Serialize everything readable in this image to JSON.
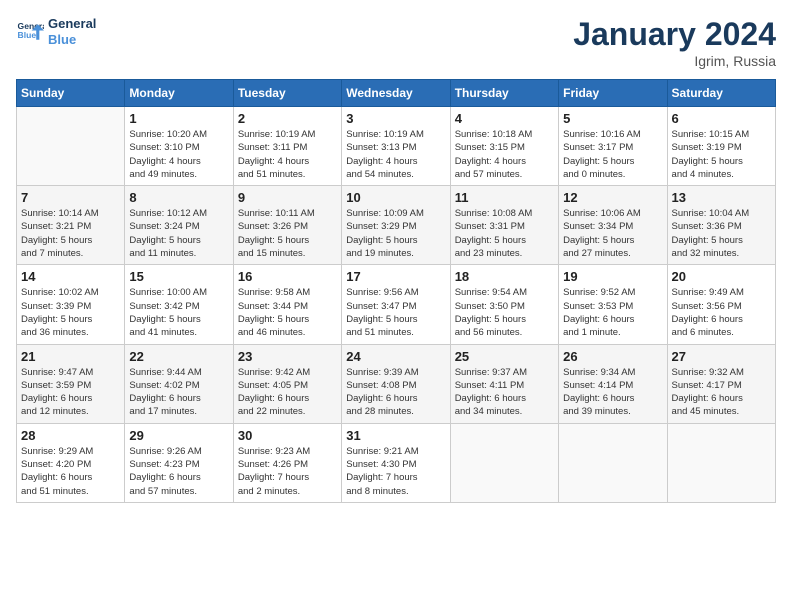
{
  "header": {
    "logo_line1": "General",
    "logo_line2": "Blue",
    "month": "January 2024",
    "location": "Igrim, Russia"
  },
  "weekdays": [
    "Sunday",
    "Monday",
    "Tuesday",
    "Wednesday",
    "Thursday",
    "Friday",
    "Saturday"
  ],
  "weeks": [
    [
      {
        "day": "",
        "info": ""
      },
      {
        "day": "1",
        "info": "Sunrise: 10:20 AM\nSunset: 3:10 PM\nDaylight: 4 hours\nand 49 minutes."
      },
      {
        "day": "2",
        "info": "Sunrise: 10:19 AM\nSunset: 3:11 PM\nDaylight: 4 hours\nand 51 minutes."
      },
      {
        "day": "3",
        "info": "Sunrise: 10:19 AM\nSunset: 3:13 PM\nDaylight: 4 hours\nand 54 minutes."
      },
      {
        "day": "4",
        "info": "Sunrise: 10:18 AM\nSunset: 3:15 PM\nDaylight: 4 hours\nand 57 minutes."
      },
      {
        "day": "5",
        "info": "Sunrise: 10:16 AM\nSunset: 3:17 PM\nDaylight: 5 hours\nand 0 minutes."
      },
      {
        "day": "6",
        "info": "Sunrise: 10:15 AM\nSunset: 3:19 PM\nDaylight: 5 hours\nand 4 minutes."
      }
    ],
    [
      {
        "day": "7",
        "info": "Sunrise: 10:14 AM\nSunset: 3:21 PM\nDaylight: 5 hours\nand 7 minutes."
      },
      {
        "day": "8",
        "info": "Sunrise: 10:12 AM\nSunset: 3:24 PM\nDaylight: 5 hours\nand 11 minutes."
      },
      {
        "day": "9",
        "info": "Sunrise: 10:11 AM\nSunset: 3:26 PM\nDaylight: 5 hours\nand 15 minutes."
      },
      {
        "day": "10",
        "info": "Sunrise: 10:09 AM\nSunset: 3:29 PM\nDaylight: 5 hours\nand 19 minutes."
      },
      {
        "day": "11",
        "info": "Sunrise: 10:08 AM\nSunset: 3:31 PM\nDaylight: 5 hours\nand 23 minutes."
      },
      {
        "day": "12",
        "info": "Sunrise: 10:06 AM\nSunset: 3:34 PM\nDaylight: 5 hours\nand 27 minutes."
      },
      {
        "day": "13",
        "info": "Sunrise: 10:04 AM\nSunset: 3:36 PM\nDaylight: 5 hours\nand 32 minutes."
      }
    ],
    [
      {
        "day": "14",
        "info": "Sunrise: 10:02 AM\nSunset: 3:39 PM\nDaylight: 5 hours\nand 36 minutes."
      },
      {
        "day": "15",
        "info": "Sunrise: 10:00 AM\nSunset: 3:42 PM\nDaylight: 5 hours\nand 41 minutes."
      },
      {
        "day": "16",
        "info": "Sunrise: 9:58 AM\nSunset: 3:44 PM\nDaylight: 5 hours\nand 46 minutes."
      },
      {
        "day": "17",
        "info": "Sunrise: 9:56 AM\nSunset: 3:47 PM\nDaylight: 5 hours\nand 51 minutes."
      },
      {
        "day": "18",
        "info": "Sunrise: 9:54 AM\nSunset: 3:50 PM\nDaylight: 5 hours\nand 56 minutes."
      },
      {
        "day": "19",
        "info": "Sunrise: 9:52 AM\nSunset: 3:53 PM\nDaylight: 6 hours\nand 1 minute."
      },
      {
        "day": "20",
        "info": "Sunrise: 9:49 AM\nSunset: 3:56 PM\nDaylight: 6 hours\nand 6 minutes."
      }
    ],
    [
      {
        "day": "21",
        "info": "Sunrise: 9:47 AM\nSunset: 3:59 PM\nDaylight: 6 hours\nand 12 minutes."
      },
      {
        "day": "22",
        "info": "Sunrise: 9:44 AM\nSunset: 4:02 PM\nDaylight: 6 hours\nand 17 minutes."
      },
      {
        "day": "23",
        "info": "Sunrise: 9:42 AM\nSunset: 4:05 PM\nDaylight: 6 hours\nand 22 minutes."
      },
      {
        "day": "24",
        "info": "Sunrise: 9:39 AM\nSunset: 4:08 PM\nDaylight: 6 hours\nand 28 minutes."
      },
      {
        "day": "25",
        "info": "Sunrise: 9:37 AM\nSunset: 4:11 PM\nDaylight: 6 hours\nand 34 minutes."
      },
      {
        "day": "26",
        "info": "Sunrise: 9:34 AM\nSunset: 4:14 PM\nDaylight: 6 hours\nand 39 minutes."
      },
      {
        "day": "27",
        "info": "Sunrise: 9:32 AM\nSunset: 4:17 PM\nDaylight: 6 hours\nand 45 minutes."
      }
    ],
    [
      {
        "day": "28",
        "info": "Sunrise: 9:29 AM\nSunset: 4:20 PM\nDaylight: 6 hours\nand 51 minutes."
      },
      {
        "day": "29",
        "info": "Sunrise: 9:26 AM\nSunset: 4:23 PM\nDaylight: 6 hours\nand 57 minutes."
      },
      {
        "day": "30",
        "info": "Sunrise: 9:23 AM\nSunset: 4:26 PM\nDaylight: 7 hours\nand 2 minutes."
      },
      {
        "day": "31",
        "info": "Sunrise: 9:21 AM\nSunset: 4:30 PM\nDaylight: 7 hours\nand 8 minutes."
      },
      {
        "day": "",
        "info": ""
      },
      {
        "day": "",
        "info": ""
      },
      {
        "day": "",
        "info": ""
      }
    ]
  ]
}
